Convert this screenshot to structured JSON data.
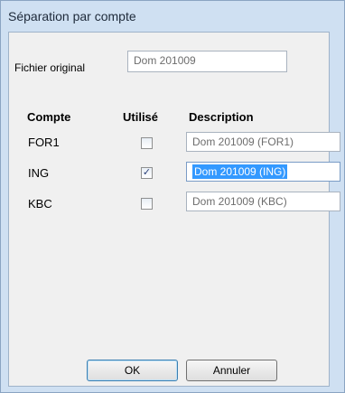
{
  "window": {
    "title": "Séparation par compte"
  },
  "original_file": {
    "label": "Fichier original",
    "value": "Dom 201009"
  },
  "table": {
    "headers": {
      "account": "Compte",
      "used": "Utilisé",
      "description": "Description"
    },
    "rows": [
      {
        "account": "FOR1",
        "used": false,
        "check_glyph": "",
        "description": "Dom 201009 (FOR1)"
      },
      {
        "account": "ING",
        "used": true,
        "check_glyph": "✓",
        "description": "Dom 201009 (ING)"
      },
      {
        "account": "KBC",
        "used": false,
        "check_glyph": "",
        "description": "Dom 201009 (KBC)"
      }
    ]
  },
  "buttons": {
    "ok": "OK",
    "cancel": "Annuler"
  },
  "colors": {
    "window_frame": "#cfe0f2",
    "client_bg": "#f0f0f0",
    "selection": "#3399ff"
  }
}
